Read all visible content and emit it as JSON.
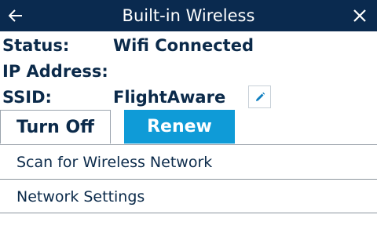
{
  "header": {
    "title": "Built-in Wireless",
    "back_icon": "arrow-left-icon",
    "close_icon": "close-icon",
    "background_color": "#0a2a4f"
  },
  "info": {
    "status_label": "Status:",
    "status_value": "Wifi Connected",
    "ip_label": "IP Address:",
    "ip_value": "",
    "ssid_label": "SSID:",
    "ssid_value": "FlightAware",
    "edit_icon": "pencil-icon"
  },
  "buttons": {
    "turn_off": "Turn Off",
    "renew": "Renew",
    "accent_color": "#0f9bd7"
  },
  "list": {
    "items": [
      {
        "label": "Scan for Wireless Network"
      },
      {
        "label": "Network Settings"
      }
    ]
  }
}
